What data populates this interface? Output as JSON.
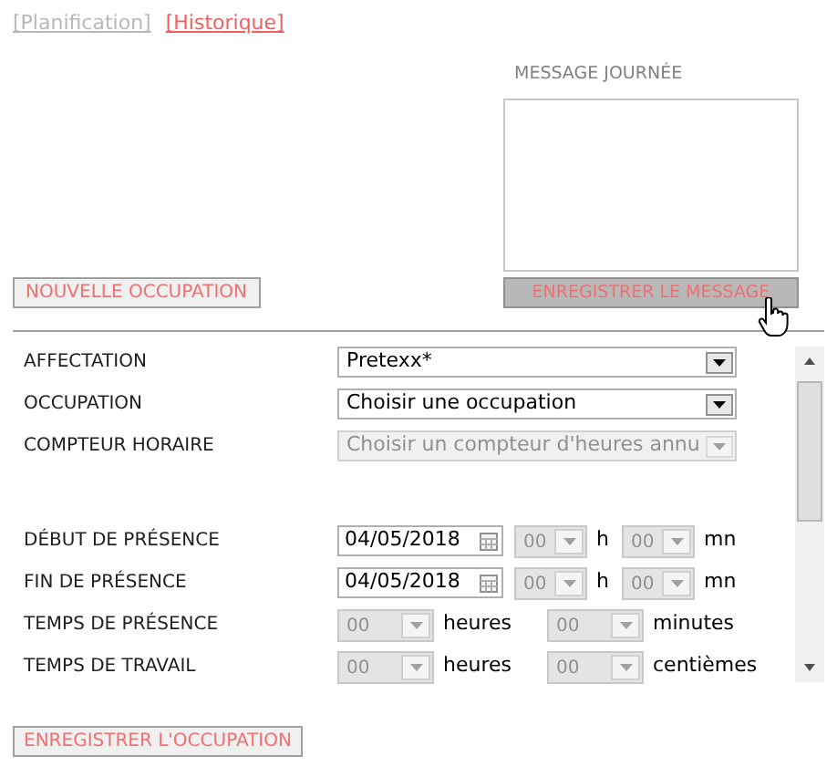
{
  "nav_links": [
    {
      "label": "[Planification]",
      "selected": false
    },
    {
      "label": "[Historique]",
      "selected": true
    }
  ],
  "message": {
    "label": "MESSAGE JOURNÉE",
    "save_button": "ENREGISTRER LE MESSAGE"
  },
  "new_button": "NOUVELLE OCCUPATION",
  "form_rows": [
    {
      "kind": "select",
      "label": "AFFECTATION",
      "value": "Pretexx*",
      "disabled": false
    },
    {
      "kind": "select",
      "label": "OCCUPATION",
      "value": "Choisir une occupation",
      "disabled": false
    },
    {
      "kind": "select",
      "label": "COMPTEUR HORAIRE",
      "value": "Choisir un compteur d'heures annu",
      "disabled": true
    },
    {
      "kind": "spacer"
    },
    {
      "kind": "datetime",
      "label": "DÉBUT DE PRÉSENCE",
      "date": "04/05/2018",
      "hours": "00",
      "hours_unit": "h",
      "minutes": "00",
      "minutes_unit": "mn"
    },
    {
      "kind": "datetime",
      "label": "FIN DE PRÉSENCE",
      "date": "04/05/2018",
      "hours": "00",
      "hours_unit": "h",
      "minutes": "00",
      "minutes_unit": "mn"
    },
    {
      "kind": "duration",
      "label": "TEMPS DE PRÉSENCE",
      "hours": "00",
      "hours_unit": "heures",
      "minutes": "00",
      "minutes_unit": "minutes"
    },
    {
      "kind": "duration",
      "label": "TEMPS DE TRAVAIL",
      "hours": "00",
      "hours_unit": "heures",
      "minutes": "00",
      "minutes_unit": "centièmes"
    }
  ],
  "save_occupation_button": "ENREGISTRER L'OCCUPATION"
}
